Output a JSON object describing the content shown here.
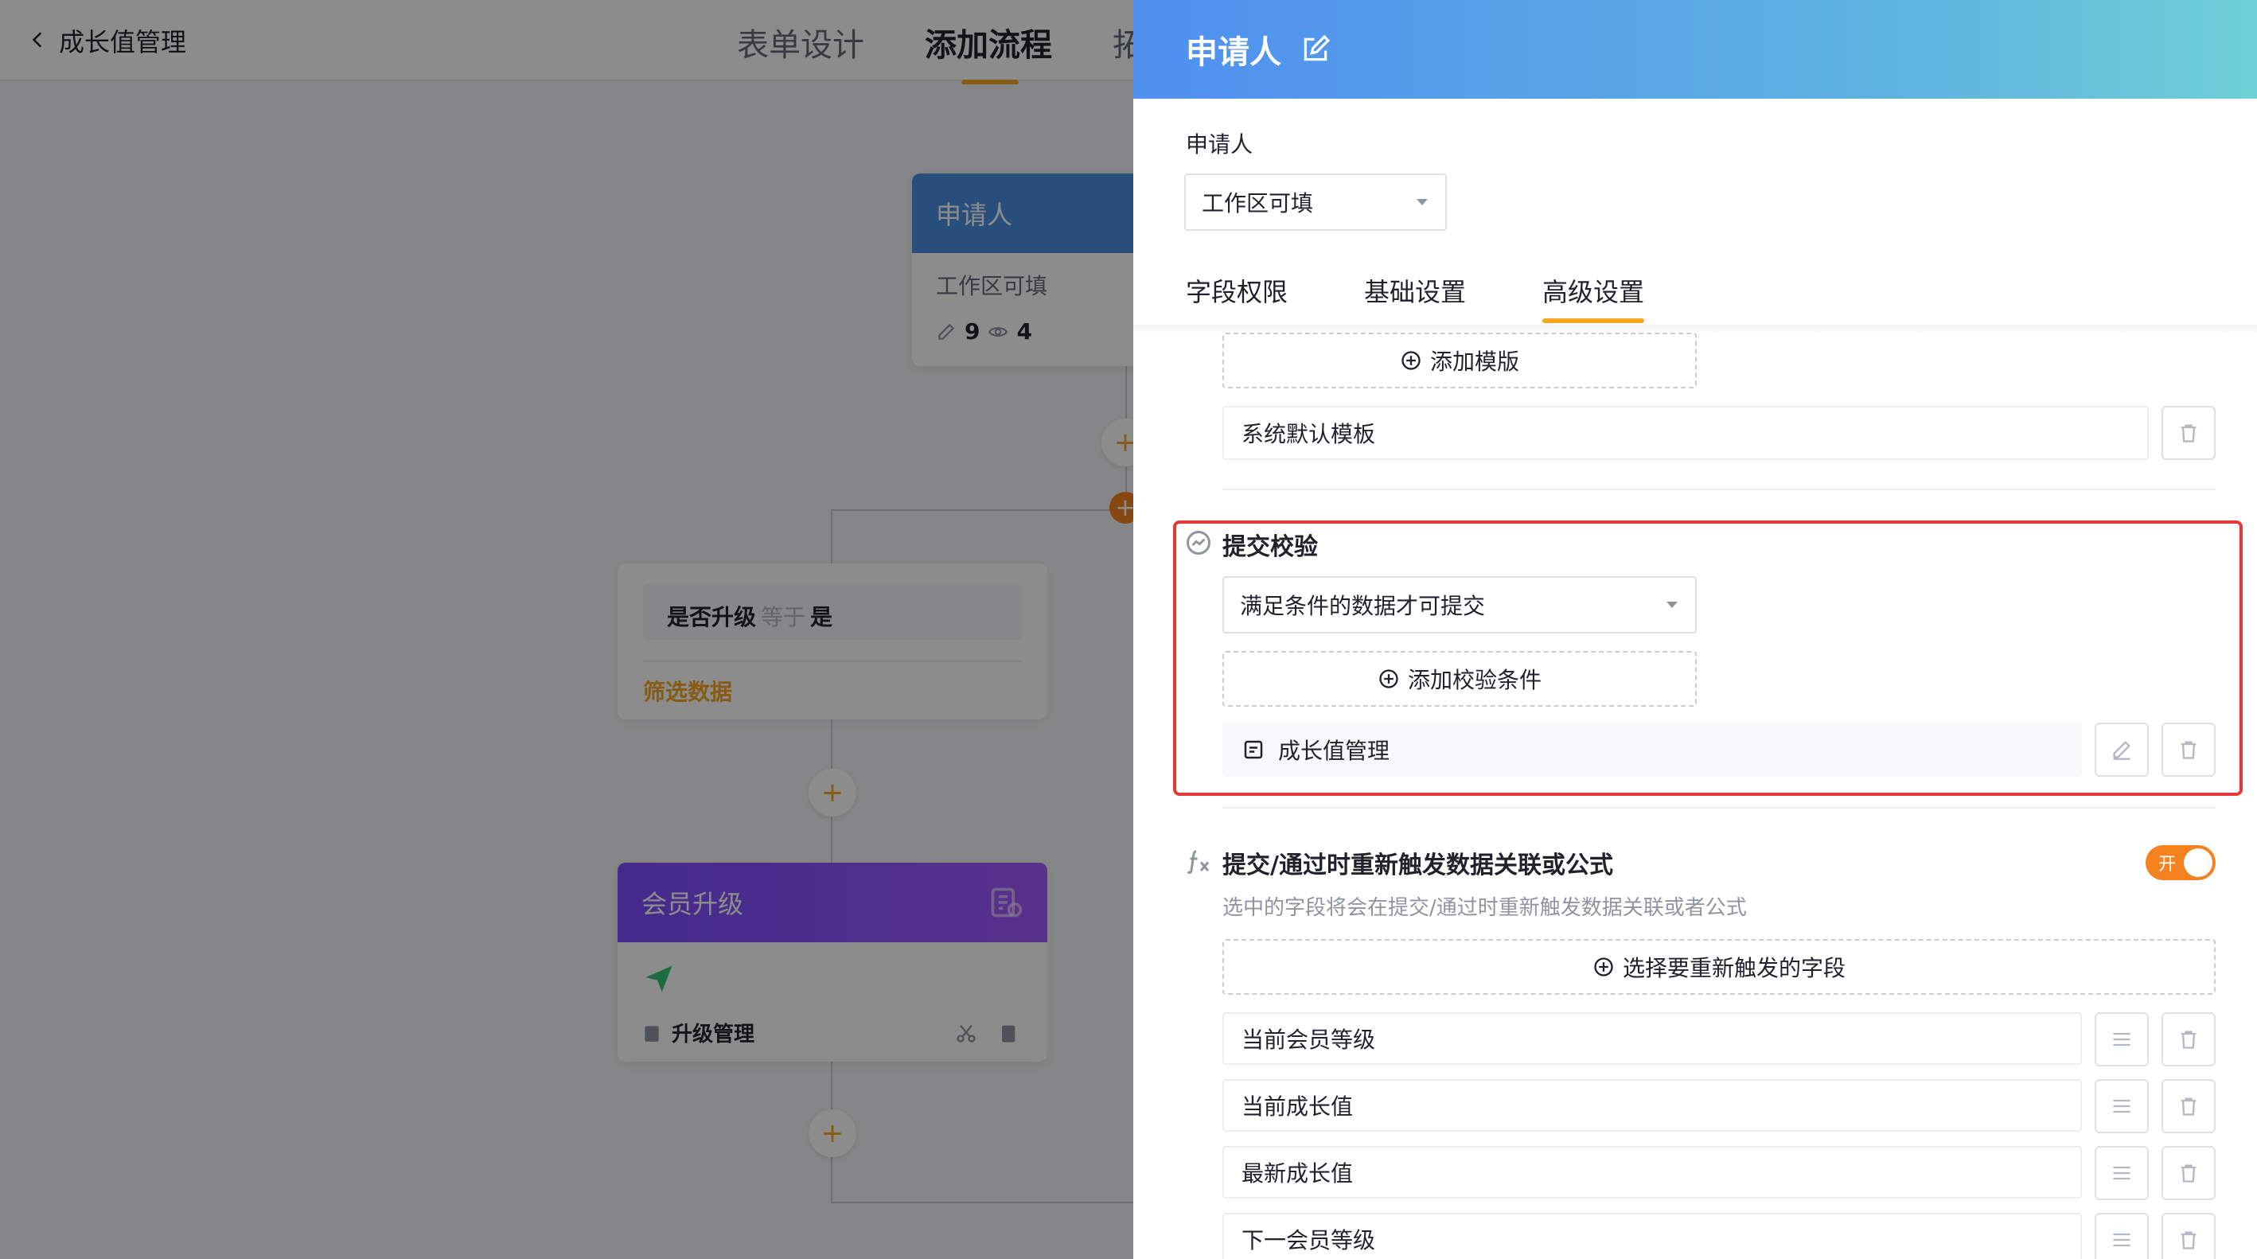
{
  "topbar": {
    "back_title": "成长值管理",
    "tabs": [
      "表单设计",
      "添加流程",
      "拓"
    ]
  },
  "canvas": {
    "applicant_node": {
      "title": "申请人",
      "subtitle": "工作区可填",
      "edit_count": "9",
      "view_count": "4"
    },
    "condition": {
      "field": "是否升级",
      "op": "等于",
      "value": "是",
      "filter": "筛选数据"
    },
    "member_node": {
      "title": "会员升级",
      "action": "升级管理"
    },
    "plus": "+"
  },
  "drawer": {
    "title": "申请人",
    "applicant_label": "申请人",
    "applicant_select": "工作区可填",
    "tabs": [
      "字段权限",
      "基础设置",
      "高级设置"
    ],
    "active_tab": "高级设置",
    "template": {
      "add_label": "添加模版",
      "item": "系统默认模板"
    },
    "validation": {
      "title": "提交校验",
      "select": "满足条件的数据才可提交",
      "add_label": "添加校验条件",
      "item": "成长值管理"
    },
    "retrigger": {
      "title": "提交/通过时重新触发数据关联或公式",
      "desc": "选中的字段将会在提交/通过时重新触发数据关联或者公式",
      "toggle_label": "开",
      "toggle_on": true,
      "add_label": "选择要重新触发的字段",
      "fields": [
        "当前会员等级",
        "当前成长值",
        "最新成长值",
        "下一会员等级"
      ]
    }
  },
  "colors": {
    "accent": "#f5a623",
    "toggle": "#f5821f",
    "highlight": "#e53935",
    "header_start": "#4f8ff0",
    "header_end": "#6fd0d6"
  }
}
